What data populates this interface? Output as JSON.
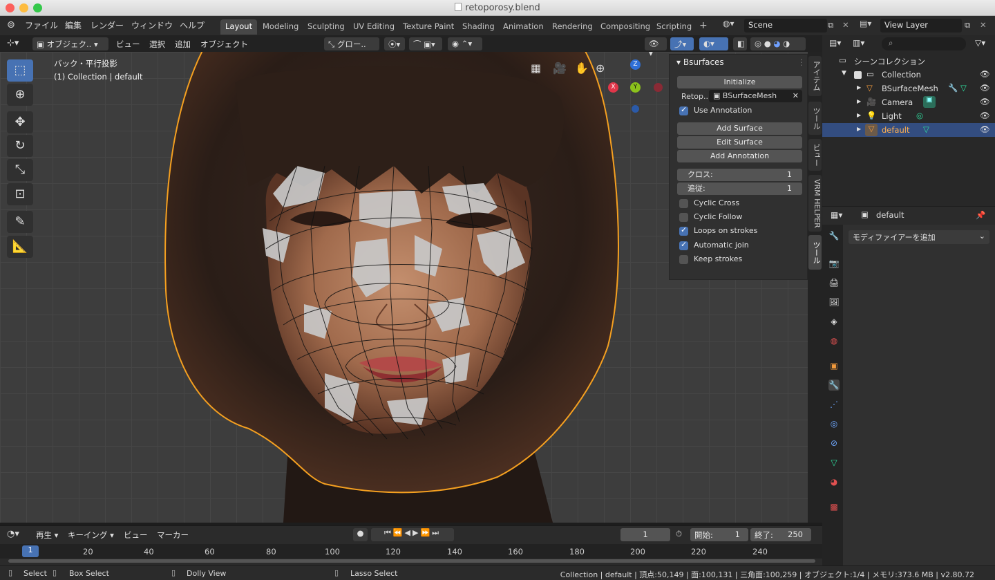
{
  "window": {
    "title": "retoporosy.blend"
  },
  "menubar": {
    "items": [
      "ファイル",
      "編集",
      "レンダー",
      "ウィンドウ",
      "ヘルプ"
    ]
  },
  "workspaces": {
    "tabs": [
      "Layout",
      "Modeling",
      "Sculpting",
      "UV Editing",
      "Texture Paint",
      "Shading",
      "Animation",
      "Rendering",
      "Compositing",
      "Scripting"
    ],
    "active": "Layout",
    "add": "+"
  },
  "scene": {
    "label": "Scene",
    "view_layer": "View Layer"
  },
  "viewport_header": {
    "mode": "オブジェク..",
    "menus": [
      "ビュー",
      "選択",
      "追加",
      "オブジェクト"
    ],
    "orientation": "グロー.."
  },
  "viewport": {
    "view_name": "バック・平行投影",
    "collection_info": "(1) Collection | default",
    "gizmo": {
      "x": "X",
      "y": "Y",
      "z": "Z"
    }
  },
  "npanel": {
    "title": "Bsurfaces",
    "initialize": "Initialize",
    "retop_label": "Retop..",
    "retop_value": "BSurfaceMesh",
    "use_annotation": "Use Annotation",
    "buttons": [
      "Add Surface",
      "Edit Surface",
      "Add Annotation"
    ],
    "cross_label": "クロス:",
    "cross_value": "1",
    "follow_label": "追従:",
    "follow_value": "1",
    "options": [
      {
        "label": "Cyclic Cross",
        "checked": false
      },
      {
        "label": "Cyclic Follow",
        "checked": false
      },
      {
        "label": "Loops on strokes",
        "checked": true
      },
      {
        "label": "Automatic join",
        "checked": true
      },
      {
        "label": "Keep strokes",
        "checked": false
      }
    ]
  },
  "side_tabs": [
    "アイテム",
    "ツール",
    "ビュー",
    "VRM HELPER",
    "ツール"
  ],
  "outliner": {
    "title": "シーンコレクション",
    "collection": "Collection",
    "items": [
      {
        "name": "BSurfaceMesh",
        "icon": "mesh-icon"
      },
      {
        "name": "Camera",
        "icon": "camera-icon"
      },
      {
        "name": "Light",
        "icon": "light-icon"
      },
      {
        "name": "default",
        "icon": "mesh-icon",
        "selected": true
      }
    ]
  },
  "properties": {
    "object_name": "default",
    "add_modifier": "モディファイアーを追加"
  },
  "timeline": {
    "menus": [
      "再生",
      "キーイング",
      "ビュー",
      "マーカー"
    ],
    "current_frame": "1",
    "start_label": "開始:",
    "start_value": "1",
    "end_label": "終了:",
    "end_value": "250",
    "ticks": [
      "1",
      "20",
      "40",
      "60",
      "80",
      "100",
      "120",
      "140",
      "160",
      "180",
      "200",
      "220",
      "240"
    ]
  },
  "statusbar": {
    "select": "Select",
    "box_select": "Box Select",
    "dolly_view": "Dolly View",
    "lasso_select": "Lasso Select",
    "info": "Collection | default | 頂点:50,149 | 面:100,131 | 三角面:100,259 | オブジェクト:1/4 | メモリ:373.6 MB | v2.80.72"
  },
  "colors": {
    "accent": "#4772b3",
    "selection": "#334d80",
    "outline": "#f5a020"
  }
}
